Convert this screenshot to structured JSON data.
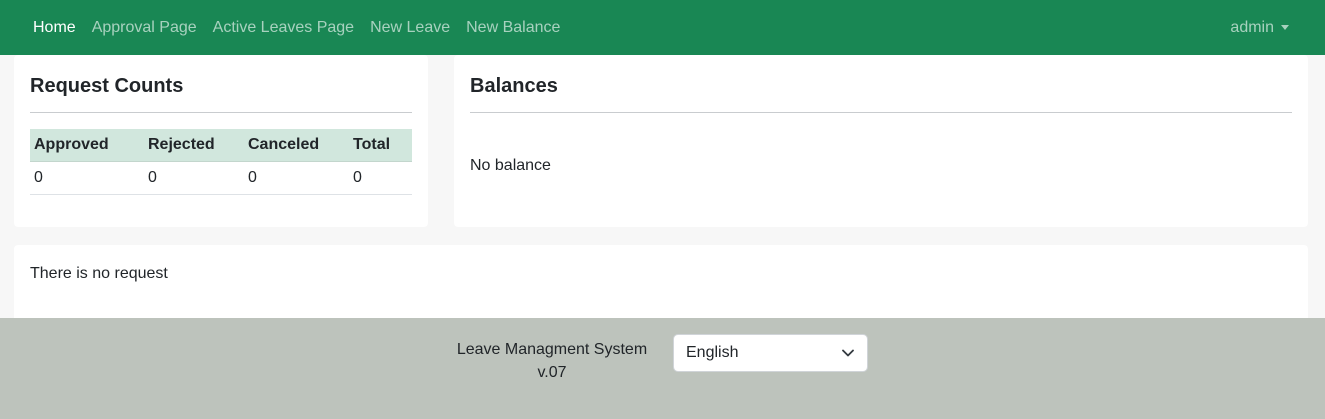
{
  "navbar": {
    "links": [
      "Home",
      "Approval Page",
      "Active Leaves Page",
      "New Leave",
      "New Balance"
    ],
    "user": "admin"
  },
  "counts_card": {
    "title": "Request Counts",
    "columns": [
      "Approved",
      "Rejected",
      "Canceled",
      "Total"
    ],
    "values": [
      "0",
      "0",
      "0",
      "0"
    ]
  },
  "balances_card": {
    "title": "Balances",
    "empty_text": "No balance"
  },
  "requests_card": {
    "empty_text": "There is no request"
  },
  "footer": {
    "app_name": "Leave Managment System",
    "version": "v.07",
    "language": "English"
  },
  "colors": {
    "navbar": "#198754",
    "table_header": "#d1e7dd",
    "footer": "#bdc3bc"
  }
}
